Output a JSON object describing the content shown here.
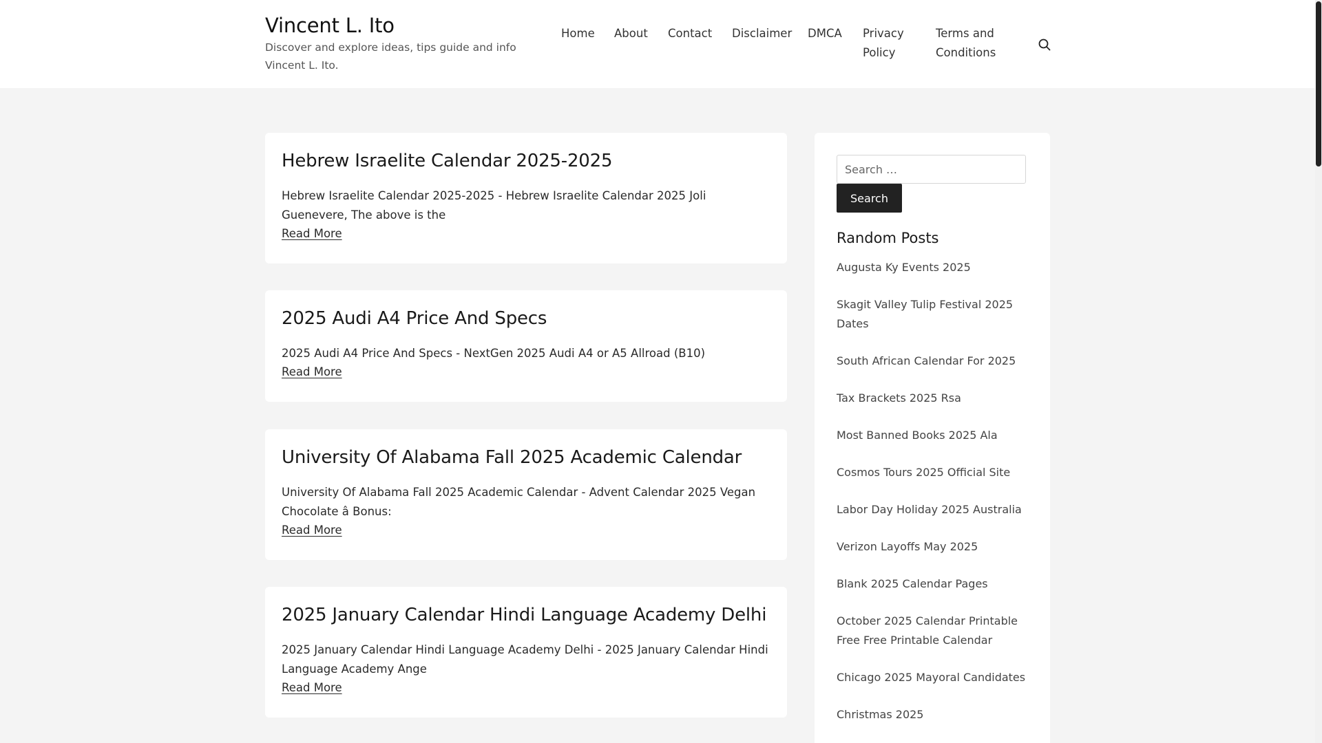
{
  "site": {
    "title": "Vincent L. Ito",
    "description": "Discover and explore ideas, tips guide and info Vincent L. Ito."
  },
  "nav": {
    "items": [
      "Home",
      "About",
      "Contact",
      "Disclaimer",
      "DMCA",
      "Privacy Policy",
      "Terms and Conditions"
    ],
    "search_icon": "search-icon"
  },
  "posts": [
    {
      "title": "Hebrew Israelite Calendar 2025-2025",
      "excerpt": "Hebrew Israelite Calendar 2025-2025 - Hebrew Israelite Calendar 2025 Joli Guenevere, The above is the",
      "read_more": "Read More"
    },
    {
      "title": "2025 Audi A4 Price And Specs",
      "excerpt": "2025 Audi A4 Price And Specs - NextGen 2025 Audi A4 or A5 Allroad (B10)",
      "read_more": "Read More"
    },
    {
      "title": "University Of Alabama Fall 2025 Academic Calendar",
      "excerpt": "University Of Alabama Fall 2025 Academic Calendar - Advent Calendar 2025 Vegan Chocolate â Bonus:",
      "read_more": "Read More"
    },
    {
      "title": "2025 January Calendar Hindi Language Academy Delhi",
      "excerpt": "2025 January Calendar Hindi Language Academy Delhi - 2025 January Calendar Hindi Language Academy Ange",
      "read_more": "Read More"
    }
  ],
  "sidebar": {
    "search_placeholder": "Search …",
    "search_button": "Search",
    "random_title": "Random Posts",
    "random_posts": [
      "Augusta Ky Events 2025",
      "Skagit Valley Tulip Festival 2025 Dates",
      "South African Calendar For 2025",
      "Tax Brackets 2025 Rsa",
      "Most Banned Books 2025 Ala",
      "Cosmos Tours 2025 Official Site",
      "Labor Day Holiday 2025 Australia",
      "Verizon Layoffs May 2025",
      "Blank 2025 Calendar Pages",
      "October 2025 Calendar Printable Free Free Printable Calendar",
      "Chicago 2025 Mayoral Candidates",
      "Christmas 2025"
    ]
  }
}
